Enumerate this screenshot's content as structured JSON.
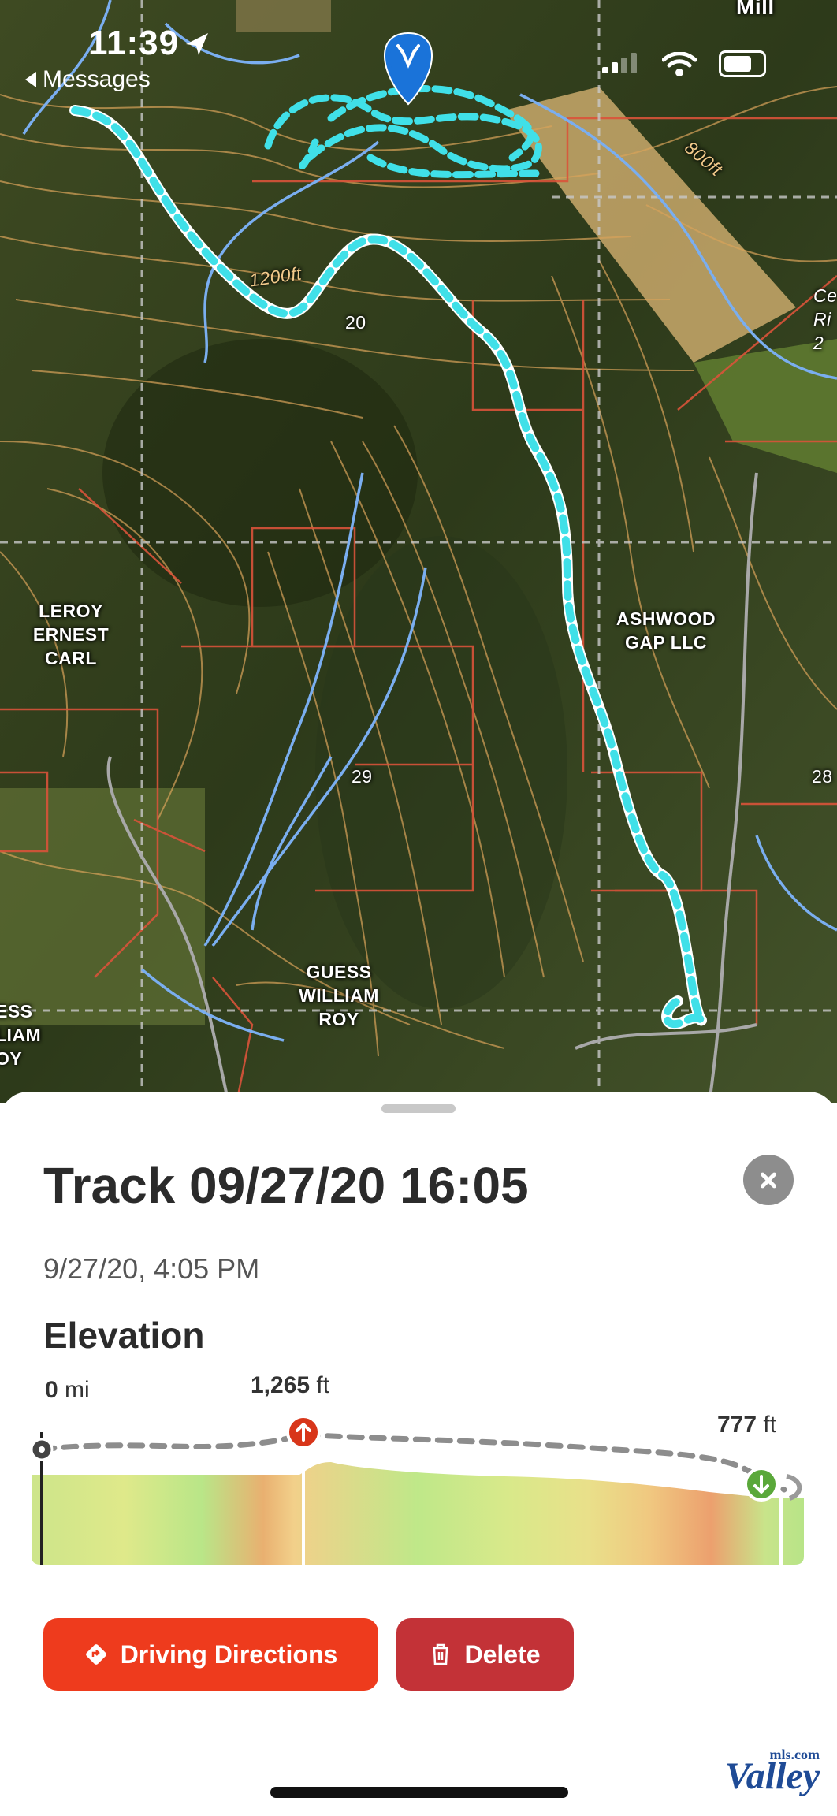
{
  "status_bar": {
    "time": "11:39",
    "back_app": "Messages"
  },
  "map": {
    "labels": {
      "leroy": "LEROY\nERNEST\nCARL",
      "ashwood": "ASHWOOD\nGAP LLC",
      "guess": "GUESS\nWILLIAM\nROY",
      "guess_partial": "ESS\nLIAM\nOY",
      "mill": "Mill",
      "ce": "Ce\nRi\n2",
      "num_20": "20",
      "num_29": "29",
      "num_28": "28",
      "contour_1200": "1200ft",
      "contour_800": "800ft"
    },
    "colors": {
      "track": "#40e0e8",
      "pin": "#1a73d9",
      "parcel": "#d9533a",
      "contour": "#d9a35a",
      "water": "#7aaef0"
    }
  },
  "panel": {
    "title": "Track 09/27/20 16:05",
    "date": "9/27/20, 4:05 PM",
    "elevation_heading": "Elevation",
    "start_value": "0",
    "start_unit": "mi",
    "max_value": "1,265",
    "max_unit": "ft",
    "end_value": "777",
    "end_unit": "ft",
    "driving_directions_label": "Driving Directions",
    "delete_label": "Delete"
  },
  "watermark": {
    "brand": "Valley",
    "suffix": "mls.com"
  },
  "chart_data": {
    "type": "line",
    "ylabel": "",
    "xlabel": "",
    "start_label": "0 mi",
    "max_label": "1,265 ft",
    "end_label": "777 ft"
  }
}
